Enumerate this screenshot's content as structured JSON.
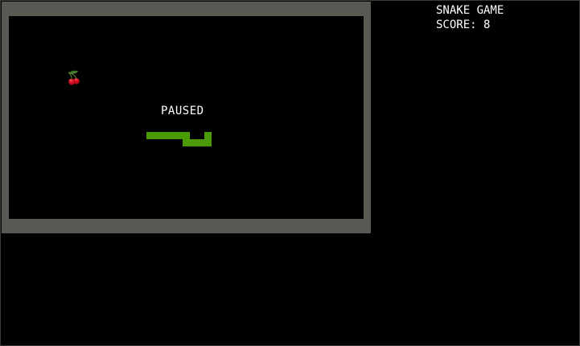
{
  "game": {
    "title": "SNAKE GAME",
    "score_text": "SCORE: 8",
    "status_text": "PAUSED"
  },
  "colors": {
    "background": "#000000",
    "border": "#575952",
    "snake": "#4a9a06",
    "text": "#ffffff"
  },
  "grid": {
    "cols": 49,
    "rows": 28
  },
  "fruit": {
    "type": "cherry",
    "glyph": "🍒",
    "col": 8,
    "row": 8
  },
  "snake": {
    "cells": [
      [
        19,
        16
      ],
      [
        20,
        16
      ],
      [
        21,
        16
      ],
      [
        22,
        16
      ],
      [
        23,
        16
      ],
      [
        24,
        16
      ],
      [
        24,
        17
      ],
      [
        25,
        17
      ],
      [
        26,
        17
      ],
      [
        27,
        17
      ],
      [
        27,
        16
      ]
    ]
  }
}
